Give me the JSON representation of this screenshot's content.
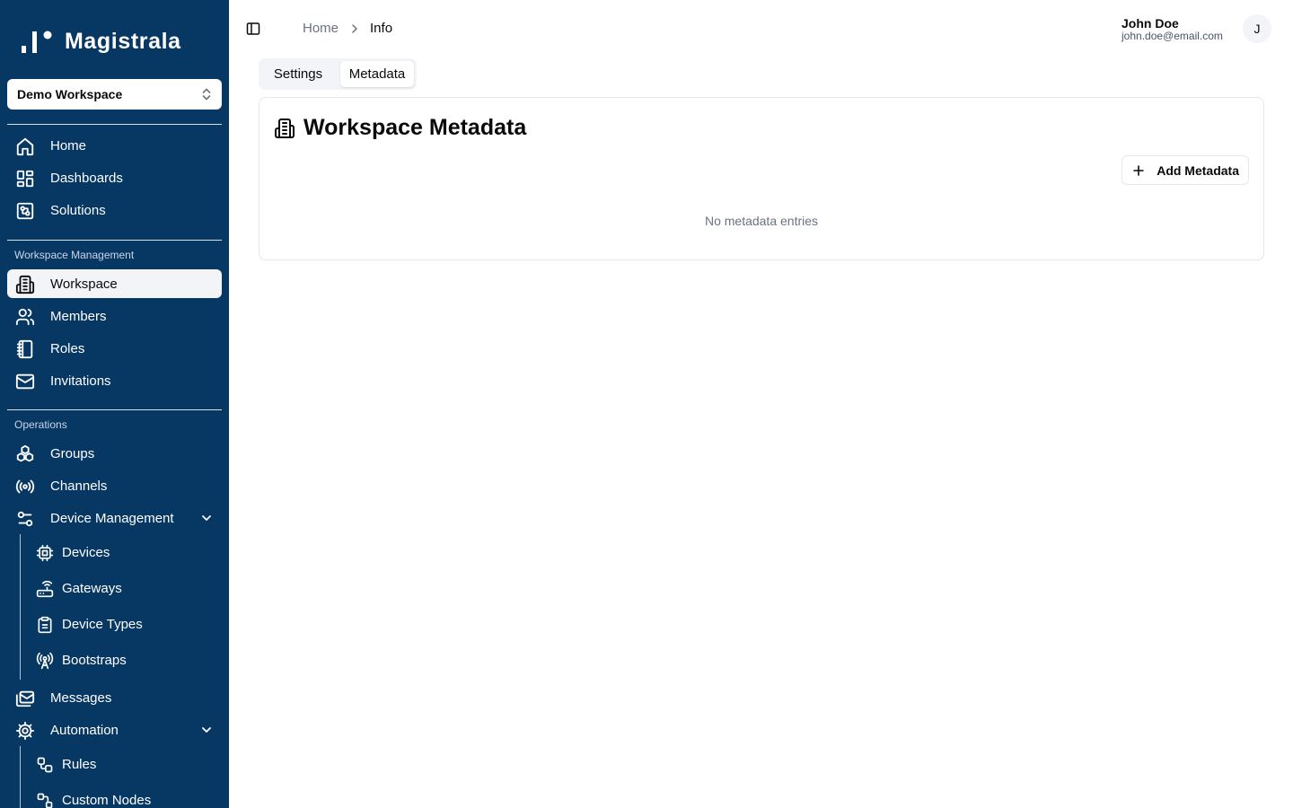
{
  "brand": {
    "name": "Magistrala"
  },
  "workspace_selector": {
    "value": "Demo Workspace"
  },
  "sidebar": {
    "main_items": [
      {
        "label": "Home",
        "icon": "home-icon"
      },
      {
        "label": "Dashboards",
        "icon": "dashboard-icon"
      },
      {
        "label": "Solutions",
        "icon": "solutions-icon"
      }
    ],
    "workspace_section": {
      "title": "Workspace Management",
      "items": [
        {
          "label": "Workspace",
          "icon": "building-icon",
          "active": true
        },
        {
          "label": "Members",
          "icon": "users-icon"
        },
        {
          "label": "Roles",
          "icon": "notebook-icon"
        },
        {
          "label": "Invitations",
          "icon": "mail-icon"
        }
      ]
    },
    "operations_section": {
      "title": "Operations",
      "items": [
        {
          "label": "Groups",
          "icon": "boxes-icon"
        },
        {
          "label": "Channels",
          "icon": "radio-icon"
        },
        {
          "label": "Device Management",
          "icon": "sliders-icon",
          "expanded": true
        },
        {
          "label": "Messages",
          "icon": "mails-icon"
        },
        {
          "label": "Automation",
          "icon": "gear-icon",
          "expanded": true
        }
      ],
      "device_management_children": [
        {
          "label": "Devices",
          "icon": "cpu-icon"
        },
        {
          "label": "Gateways",
          "icon": "router-icon"
        },
        {
          "label": "Device Types",
          "icon": "clipboard-icon"
        },
        {
          "label": "Bootstraps",
          "icon": "antenna-icon"
        }
      ],
      "automation_children": [
        {
          "label": "Rules",
          "icon": "workflow-icon"
        },
        {
          "label": "Custom Nodes",
          "icon": "nodes-icon"
        }
      ]
    }
  },
  "header": {
    "breadcrumb": {
      "home": "Home",
      "current": "Info"
    },
    "user": {
      "name": "John Doe",
      "email": "john.doe@email.com",
      "avatar_initial": "J"
    }
  },
  "tabs": {
    "settings": "Settings",
    "metadata": "Metadata",
    "active": "Metadata"
  },
  "card": {
    "title": "Workspace Metadata",
    "add_button": "Add Metadata",
    "empty_message": "No metadata entries"
  },
  "colors": {
    "sidebar_bg": "#073763",
    "active_item_bg": "#f2f4f7",
    "border": "#e5e7eb",
    "muted_text": "#6b7280"
  }
}
